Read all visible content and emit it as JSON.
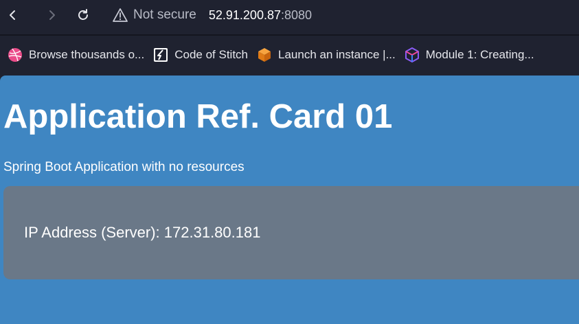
{
  "browser": {
    "back_icon": "chevron-left-icon",
    "forward_icon": "chevron-right-icon",
    "reload_icon": "reload-icon",
    "warning_icon": "warning-triangle-icon",
    "security_label": "Not secure",
    "url_host": "52.91.200.87",
    "url_port": ":8080",
    "bookmarks": [
      {
        "label": "Browse thousands o...",
        "icon": "dribbble-icon",
        "color": "#ea4c89"
      },
      {
        "label": "Code of Stitch",
        "icon": "stitch-icon",
        "color": "#ffffff"
      },
      {
        "label": "Launch an instance |...",
        "icon": "aws-cube-icon",
        "color": "#f28c28"
      },
      {
        "label": "Module 1: Creating...",
        "icon": "module-cube-icon",
        "color": "#8b5cf6"
      }
    ]
  },
  "page": {
    "title": "Application Ref. Card 01",
    "subtitle": "Spring Boot Application with no resources",
    "ip_line": "IP Address (Server): 172.31.80.181",
    "background_color": "#3f86c2",
    "card_color": "#6a7888"
  }
}
